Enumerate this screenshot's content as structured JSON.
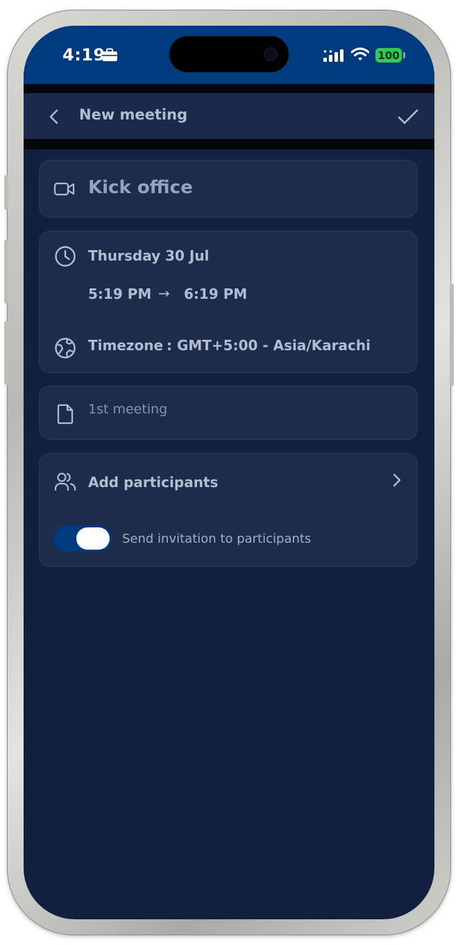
{
  "status_bar": {
    "time": "4:19",
    "battery": "100",
    "icons": [
      "briefcase-icon",
      "signal-icon",
      "wifi-icon",
      "battery-icon"
    ]
  },
  "header": {
    "title": "New meeting",
    "back_icon": "chevron-left-icon",
    "confirm_icon": "checkmark-icon"
  },
  "meeting": {
    "title": "Kick office",
    "title_icon": "video-camera-icon",
    "date": "Thursday 30 Jul",
    "date_icon": "clock-icon",
    "start_time": "5:19 PM",
    "arrow": "→",
    "end_time": "6:19 PM",
    "timezone_label": "Timezone",
    "timezone_value": ": GMT+5:00 - Asia/Karachi",
    "timezone_icon": "globe-icon",
    "note": "1st meeting",
    "note_icon": "document-icon"
  },
  "participants": {
    "label": "Add participants",
    "icon": "people-icon",
    "chevron_icon": "chevron-right-icon",
    "invite_label": "Send invitation to participants",
    "invite_enabled": true
  },
  "colors": {
    "status_bar": "#003a7e",
    "screen_bg": "#121f3e",
    "header_bg": "#1b2a4a",
    "card_bg": "#1e2c4b",
    "toggle_on": "#003a7e",
    "battery": "#34c759"
  }
}
